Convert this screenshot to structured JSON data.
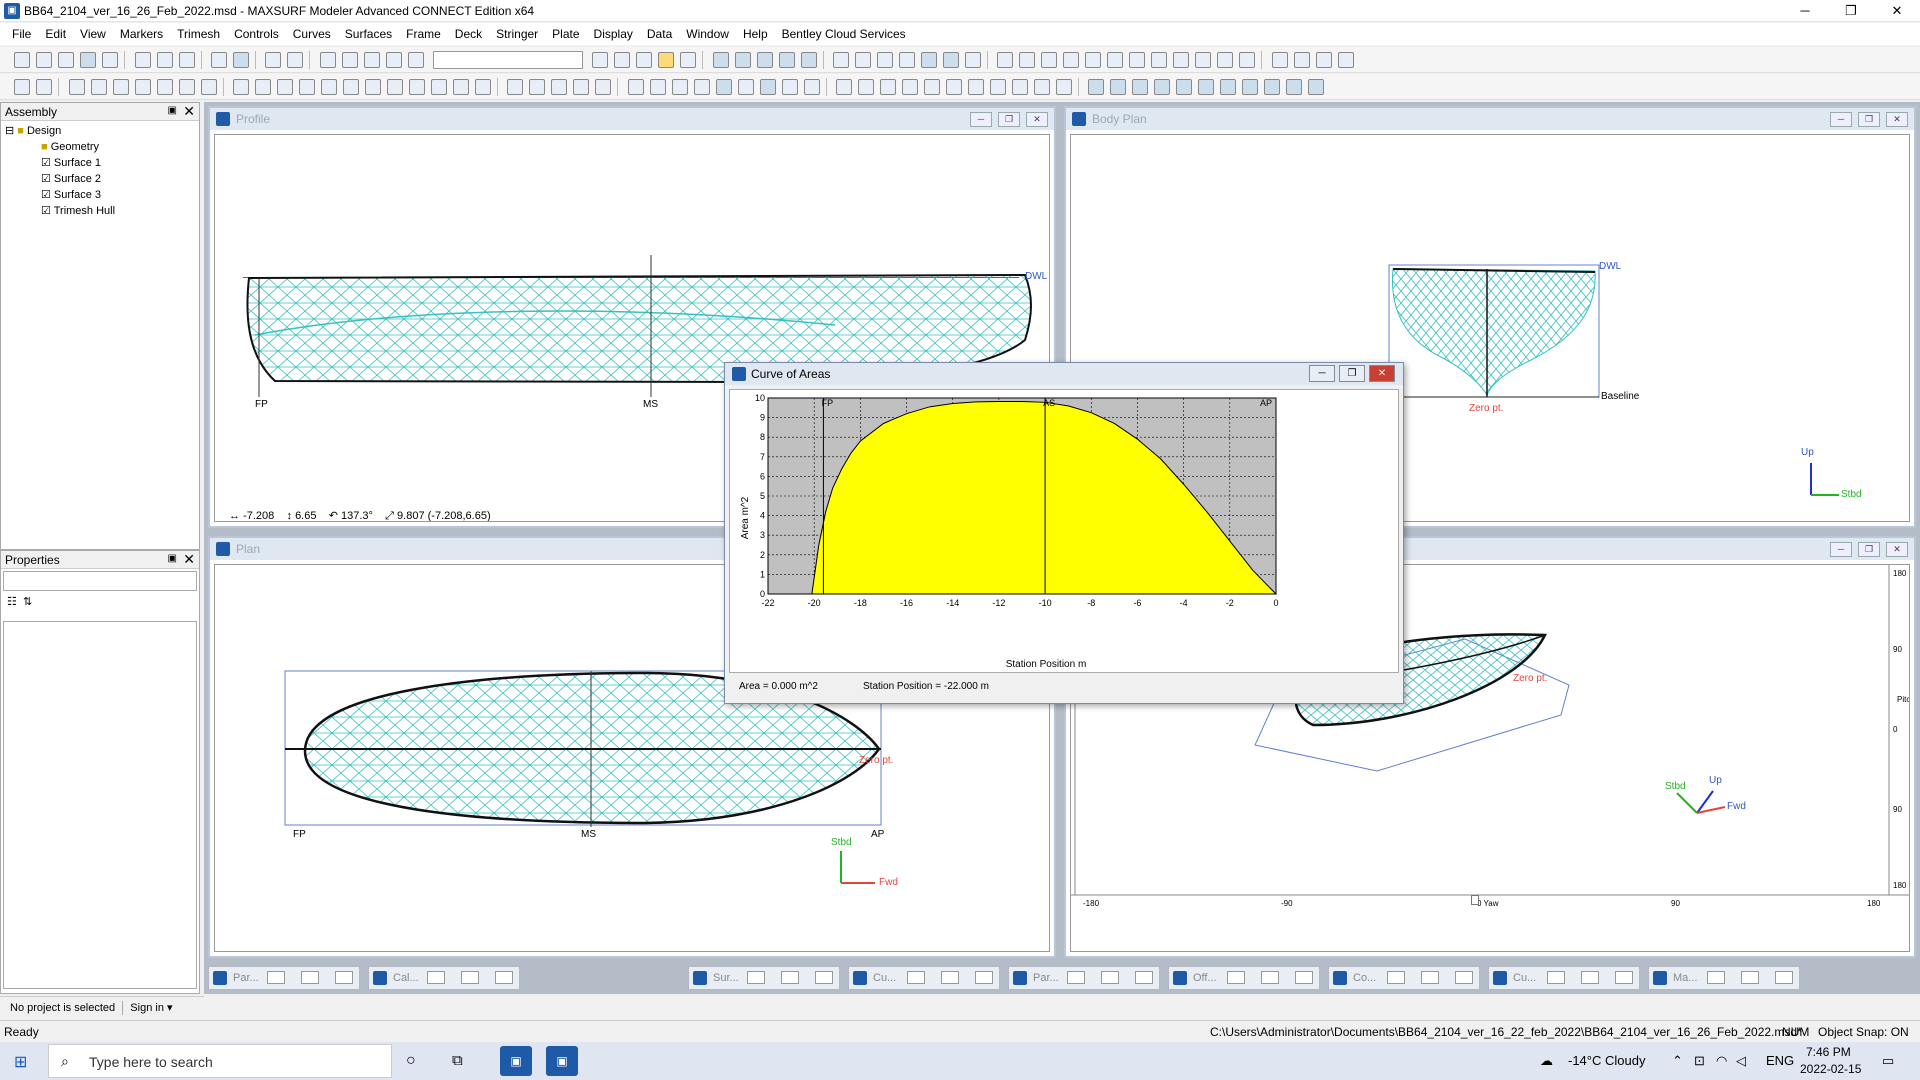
{
  "window": {
    "title": "BB64_2104_ver_16_26_Feb_2022.msd - MAXSURF Modeler Advanced CONNECT Edition x64",
    "minimize": "─",
    "maximize": "❐",
    "close": "✕"
  },
  "menu": [
    "File",
    "Edit",
    "View",
    "Markers",
    "Trimesh",
    "Controls",
    "Curves",
    "Surfaces",
    "Frame",
    "Deck",
    "Stringer",
    "Plate",
    "Display",
    "Data",
    "Window",
    "Help",
    "Bentley Cloud Services"
  ],
  "assembly": {
    "title": "Assembly",
    "items": [
      "Design",
      "Geometry",
      "Surface 1",
      "Surface 2",
      "Surface 3",
      "Trimesh Hull"
    ]
  },
  "properties": {
    "title": "Properties"
  },
  "profile": {
    "title": "Profile",
    "dwl": "DWL",
    "fp": "FP",
    "ms": "MS",
    "readout": {
      "dx": "-7.208",
      "dy": "6.65",
      "angle": "137.3°",
      "dist": "9.807 (-7.208,6.65)"
    }
  },
  "bodyplan": {
    "title": "Body Plan",
    "dwl": "DWL",
    "baseline": "Baseline",
    "zero": "Zero pt.",
    "up": "Up",
    "stbd": "Stbd"
  },
  "plan": {
    "title": "Plan",
    "fp": "FP",
    "ms": "MS",
    "ap": "AP",
    "zero": "Zero pt.",
    "stbd": "Stbd",
    "fwd": "Fwd"
  },
  "perspective": {
    "zero": "Zero pt.",
    "stbd": "Stbd",
    "up": "Up",
    "fwd": "Fwd",
    "ruler_bottom": [
      "-180",
      "-90",
      "0 Yaw",
      "90",
      "180"
    ],
    "ruler_right": [
      "180",
      "90",
      "0",
      "90",
      "180"
    ],
    "pitch": "Pitch"
  },
  "curve_of_areas": {
    "title": "Curve of Areas",
    "status": {
      "area": "Area =  0.000 m^2",
      "station": "Station Position =  -22.000 m"
    }
  },
  "chart_data": {
    "type": "area",
    "title": "",
    "xlabel": "Station Position  m",
    "ylabel": "Area  m^2",
    "xlim": [
      -22,
      0
    ],
    "ylim": [
      0,
      10
    ],
    "xticks": [
      "-22",
      "-20",
      "-18",
      "-16",
      "-14",
      "-12",
      "-10",
      "-8",
      "-6",
      "-4",
      "-2",
      "0"
    ],
    "yticks": [
      "0",
      "1",
      "2",
      "3",
      "4",
      "5",
      "6",
      "7",
      "8",
      "9",
      "10"
    ],
    "markers": [
      {
        "label": "FP",
        "x": -19.6
      },
      {
        "label": "AS",
        "x": -10
      },
      {
        "label": "AP",
        "x": 0
      }
    ],
    "x": [
      -20.1,
      -19.8,
      -19.5,
      -19.2,
      -18.8,
      -18.4,
      -18,
      -17,
      -16,
      -15,
      -14,
      -13,
      -12,
      -11,
      -10,
      -9,
      -8,
      -7,
      -6,
      -5,
      -4,
      -3,
      -2,
      -1,
      0
    ],
    "y": [
      0,
      2.5,
      4.2,
      5.4,
      6.4,
      7.2,
      7.8,
      8.7,
      9.2,
      9.55,
      9.72,
      9.8,
      9.82,
      9.82,
      9.78,
      9.6,
      9.25,
      8.7,
      7.9,
      6.9,
      5.6,
      4.2,
      2.7,
      1.2,
      0
    ],
    "grid": true,
    "fill_color": "#ffff00",
    "background": "#c0c0c0"
  },
  "tasktabs": [
    "Par...",
    "Cal...",
    "Sur...",
    "Cu...",
    "Par...",
    "Off...",
    "Co...",
    "Cu...",
    "Ma..."
  ],
  "panel_status": {
    "project": "No project is selected",
    "signin": "Sign in"
  },
  "statusbar": {
    "left": "Ready",
    "path": "C:\\Users\\Administrator\\Documents\\BB64_2104_ver_16_22_feb_2022\\BB64_2104_ver_16_26_Feb_2022.msd*",
    "num": "NUM",
    "snap": "Object Snap: ON"
  },
  "taskbar": {
    "search_placeholder": "Type here to search",
    "weather": "-14°C  Cloudy",
    "lang": "ENG",
    "time": "7:46 PM",
    "date": "2022-02-15"
  },
  "colors": {
    "mesh": "#36c0c0",
    "accent": "#1e5aa8"
  }
}
